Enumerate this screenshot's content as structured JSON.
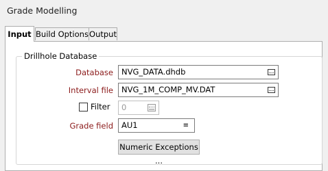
{
  "window": {
    "title": "Grade Modelling"
  },
  "tabs": [
    {
      "label": "Input",
      "active": true
    },
    {
      "label": "Build Options",
      "active": false
    },
    {
      "label": "Output",
      "active": false
    }
  ],
  "group": {
    "title": "Drillhole Database"
  },
  "fields": {
    "database": {
      "label": "Database",
      "value": "NVG_DATA.dhdb",
      "icon": "browse-icon"
    },
    "interval_file": {
      "label": "Interval file",
      "value": "NVG_1M_COMP_MV.DAT",
      "icon": "browse-icon"
    },
    "filter": {
      "label": "Filter",
      "value": "0",
      "checked": false,
      "icon": "calculator-icon"
    },
    "grade_field": {
      "label": "Grade field",
      "value": "AU1",
      "icon": "list-icon"
    }
  },
  "buttons": {
    "numeric_exceptions": "Numeric Exceptions ..."
  },
  "colors": {
    "label_color": "#8b1a1a",
    "background": "#f0f0f0"
  }
}
